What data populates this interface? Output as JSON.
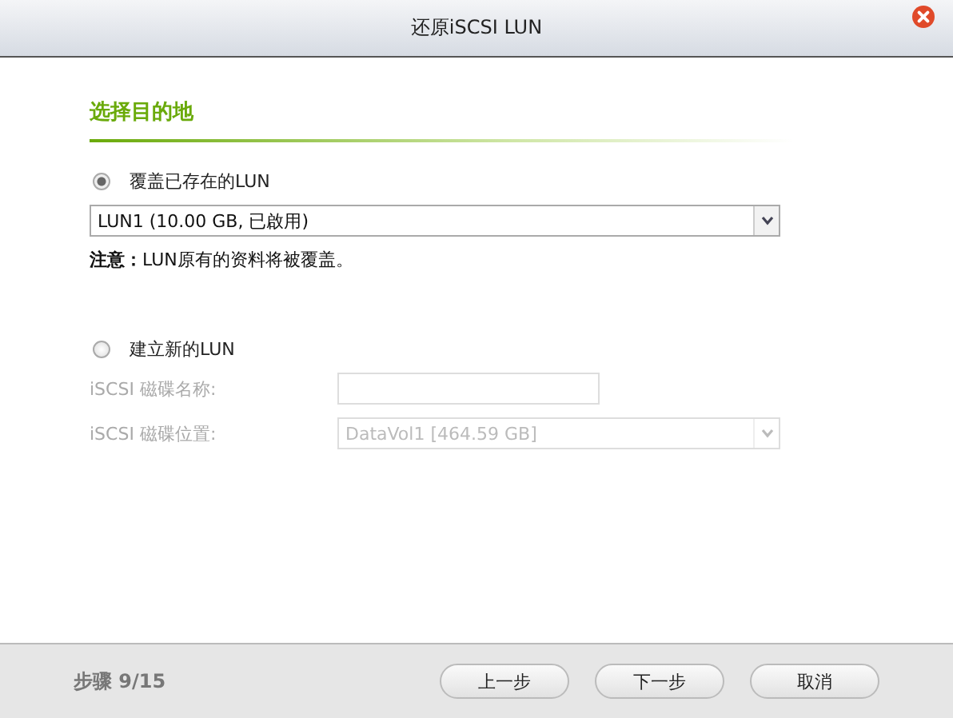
{
  "window": {
    "title": "还原iSCSI LUN"
  },
  "section_title": "选择目的地",
  "options": [
    {
      "label": "覆盖已存在的LUN",
      "selected": true
    },
    {
      "label": "建立新的LUN",
      "selected": false
    }
  ],
  "existing_lun": {
    "value": "LUN1 (10.00 GB, 已啟用)"
  },
  "note": "**注意：**LUN原有的资料将被覆盖。",
  "new_lun_fields": [
    {
      "kind": "text",
      "label": "iSCSI 磁碟名称:",
      "disabled": true
    },
    {
      "kind": "select",
      "label": "iSCSI 磁碟位置:",
      "value": "DataVol1 [464.59 GB]",
      "disabled": true
    }
  ],
  "footer": {
    "step": "步骤 9/15",
    "buttons": [
      "上一步",
      "下一步",
      "取消"
    ]
  }
}
